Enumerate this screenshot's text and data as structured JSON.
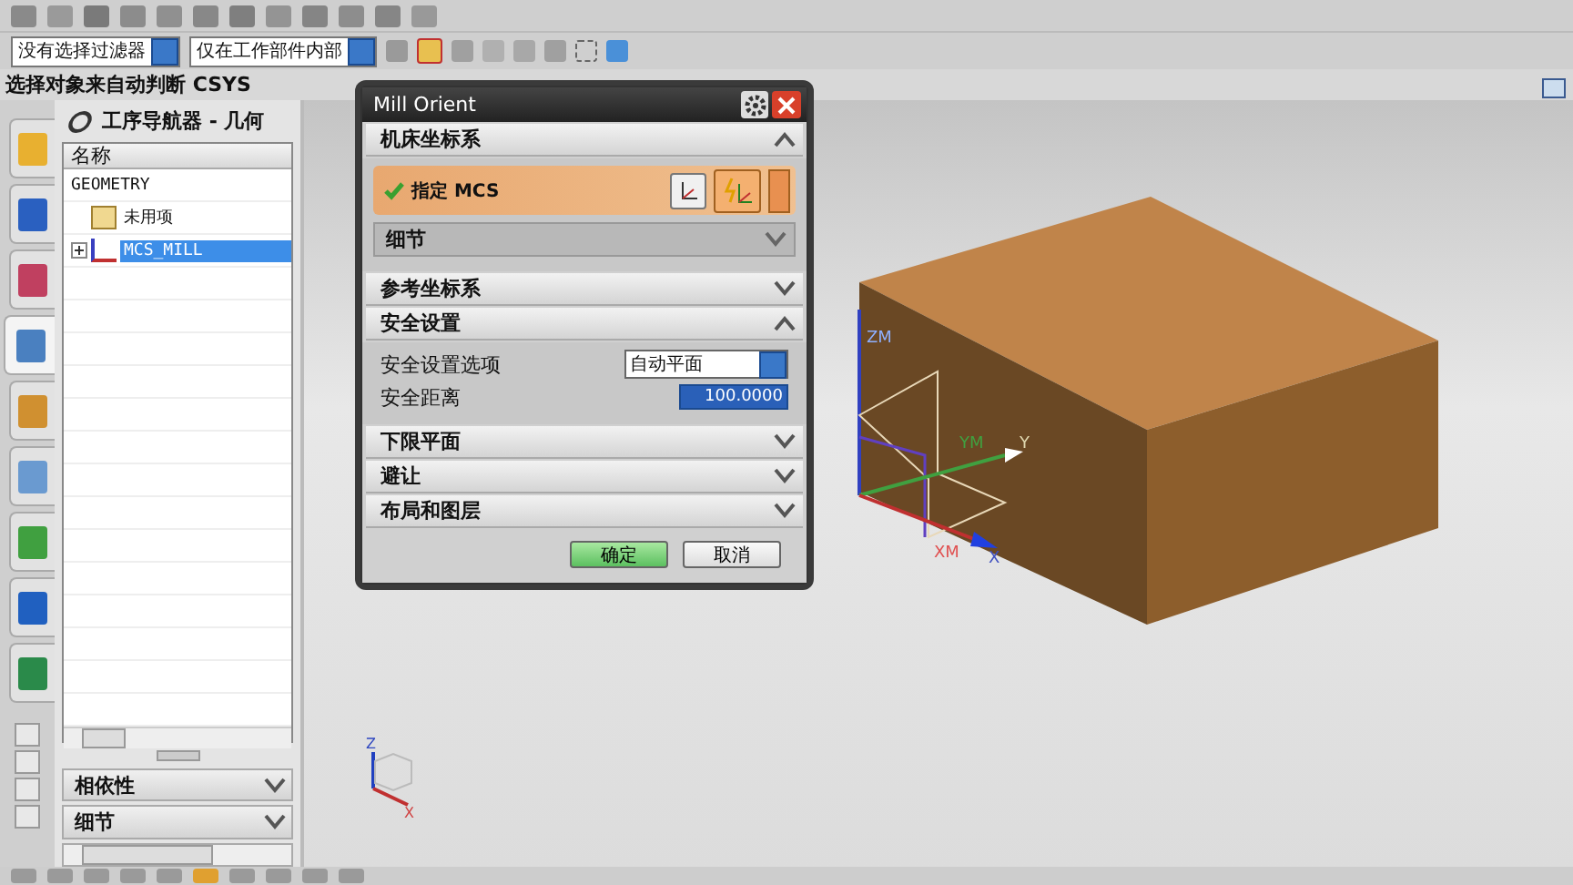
{
  "resource_tabs": [
    {
      "selected": false
    },
    {
      "selected": false
    },
    {
      "selected": false
    },
    {
      "selected": true
    },
    {
      "selected": false
    },
    {
      "selected": false
    },
    {
      "selected": false
    },
    {
      "selected": false
    },
    {
      "selected": false
    }
  ],
  "filters": [
    {
      "value": "没有选择过滤器"
    },
    {
      "value": "仅在工作部件内部"
    }
  ],
  "status_text": "选择对象来自动判断 CSYS",
  "navigator": {
    "title": "工序导航器 - 几何",
    "column": "名称",
    "tree": [
      {
        "label": "GEOMETRY",
        "selected": false,
        "children": [
          {
            "label": "未用项",
            "selected": false
          },
          {
            "label": "MCS_MILL",
            "selected": true,
            "expanded": false
          }
        ]
      }
    ],
    "sections": [
      {
        "label": "相依性",
        "expanded": false
      },
      {
        "label": "细节",
        "expanded": false
      }
    ]
  },
  "dialog": {
    "title": "Mill Orient",
    "sections": [
      {
        "label": "机床坐标系",
        "expanded": true,
        "specify": {
          "label": "指定 MCS",
          "checked": true
        },
        "sub": {
          "label": "细节",
          "expanded": false
        }
      },
      {
        "label": "参考坐标系",
        "expanded": false
      },
      {
        "label": "安全设置",
        "expanded": true,
        "fields": [
          {
            "label": "安全设置选项",
            "kind": "dropdown",
            "value": "自动平面"
          },
          {
            "label": "安全距离",
            "kind": "number",
            "value": "100.0000"
          }
        ]
      },
      {
        "label": "下限平面",
        "expanded": false
      },
      {
        "label": "避让",
        "expanded": false
      },
      {
        "label": "布局和图层",
        "expanded": false
      }
    ],
    "buttons": [
      {
        "label": "确定",
        "kind": "primary"
      },
      {
        "label": "取消",
        "kind": "secondary"
      }
    ]
  },
  "viewport": {
    "csys_labels": {
      "zm": "ZM",
      "ym": "YM",
      "y": "Y",
      "xm": "XM",
      "x": "X"
    },
    "triad_labels": {
      "z": "Z",
      "x": "X"
    }
  }
}
